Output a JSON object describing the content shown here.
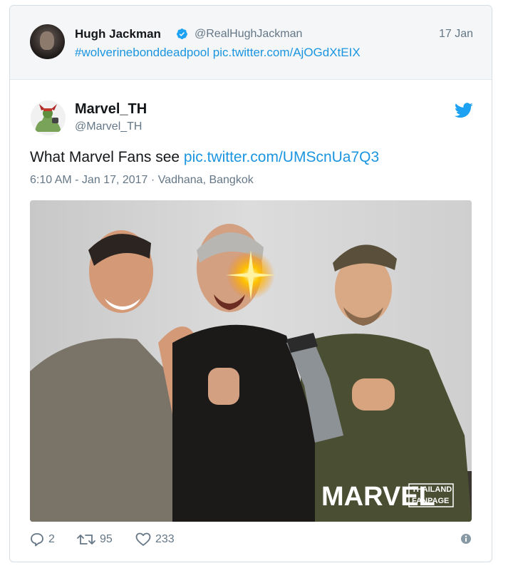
{
  "quoted": {
    "name": "Hugh Jackman",
    "handle": "@RealHughJackman",
    "date": "17 Jan",
    "hashtag": "#wolverinebonddeadpool",
    "link": "pic.twitter.com/AjOGdXtEIX"
  },
  "tweet": {
    "name": "Marvel_TH",
    "handle": "@Marvel_TH",
    "text": "What Marvel Fans see",
    "link": "pic.twitter.com/UMScnUa7Q3",
    "timestamp": "6:10 AM - Jan 17, 2017",
    "separator": "·",
    "location": "Vadhana, Bangkok"
  },
  "photo": {
    "logo_main": "MARVEL",
    "logo_sub1": "THAILAND",
    "logo_sub2": "FANPAGE"
  },
  "actions": {
    "replies": "2",
    "retweets": "95",
    "likes": "233"
  },
  "colors": {
    "link": "#1b95e0",
    "muted": "#657786",
    "header_bg": "#f4f6f8",
    "border": "#d6dde3"
  },
  "icons": [
    "verified-badge-icon",
    "twitter-bird-icon",
    "reply-icon",
    "retweet-icon",
    "like-icon",
    "info-icon"
  ]
}
